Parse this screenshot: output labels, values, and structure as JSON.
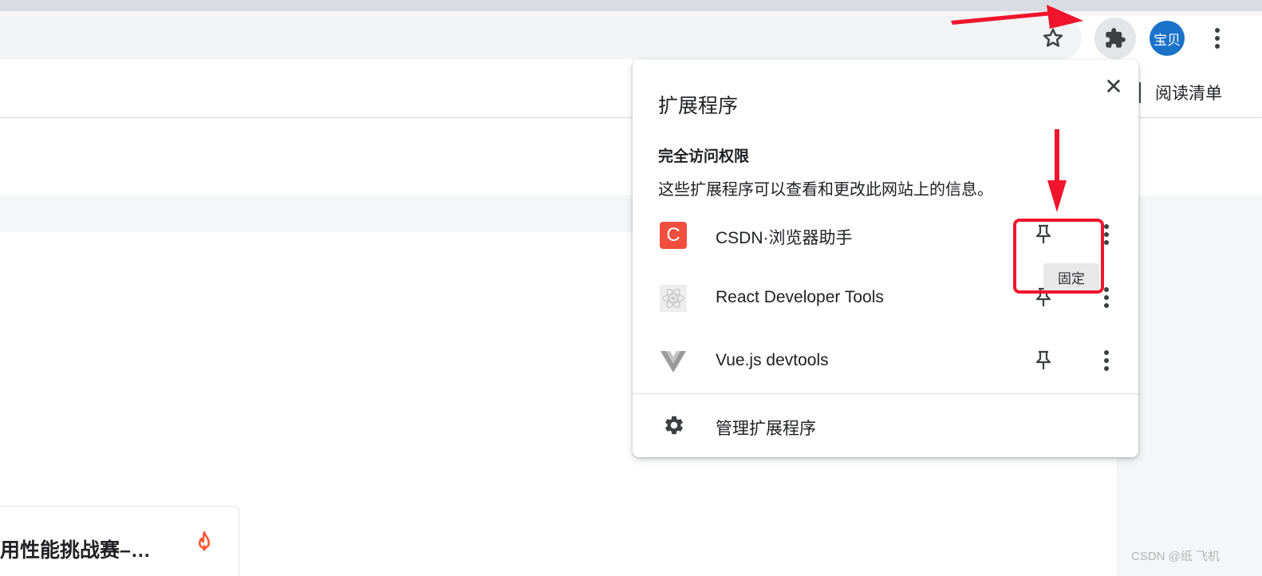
{
  "toolbar": {
    "avatar_label": "宝贝",
    "icons": [
      "star-outline-icon",
      "puzzle-icon",
      "three-dot-menu-icon"
    ]
  },
  "bookmarks_bar": {
    "reading_list_label": "阅读清单"
  },
  "extensions_popup": {
    "title": "扩展程序",
    "close_glyph": "✕",
    "section_title": "完全访问权限",
    "section_description": "这些扩展程序可以查看和更改此网站上的信息。",
    "extensions": [
      {
        "name": "CSDN·浏览器助手",
        "icon": "csdn-logo-icon",
        "icon_letter": "C",
        "icon_color": "#f04e3e"
      },
      {
        "name": "React Developer Tools",
        "icon": "react-logo-icon"
      },
      {
        "name": "Vue.js devtools",
        "icon": "vue-logo-icon"
      }
    ],
    "manage_label": "管理扩展程序",
    "pin_tooltip": "固定"
  },
  "page": {
    "card_title": "用性能挑战赛–…",
    "watermark": "CSDN @纸 飞机"
  },
  "colors": {
    "annotation_red": "#f0142d",
    "avatar_blue": "#1a73c8",
    "csdn_red": "#f04e3e"
  }
}
